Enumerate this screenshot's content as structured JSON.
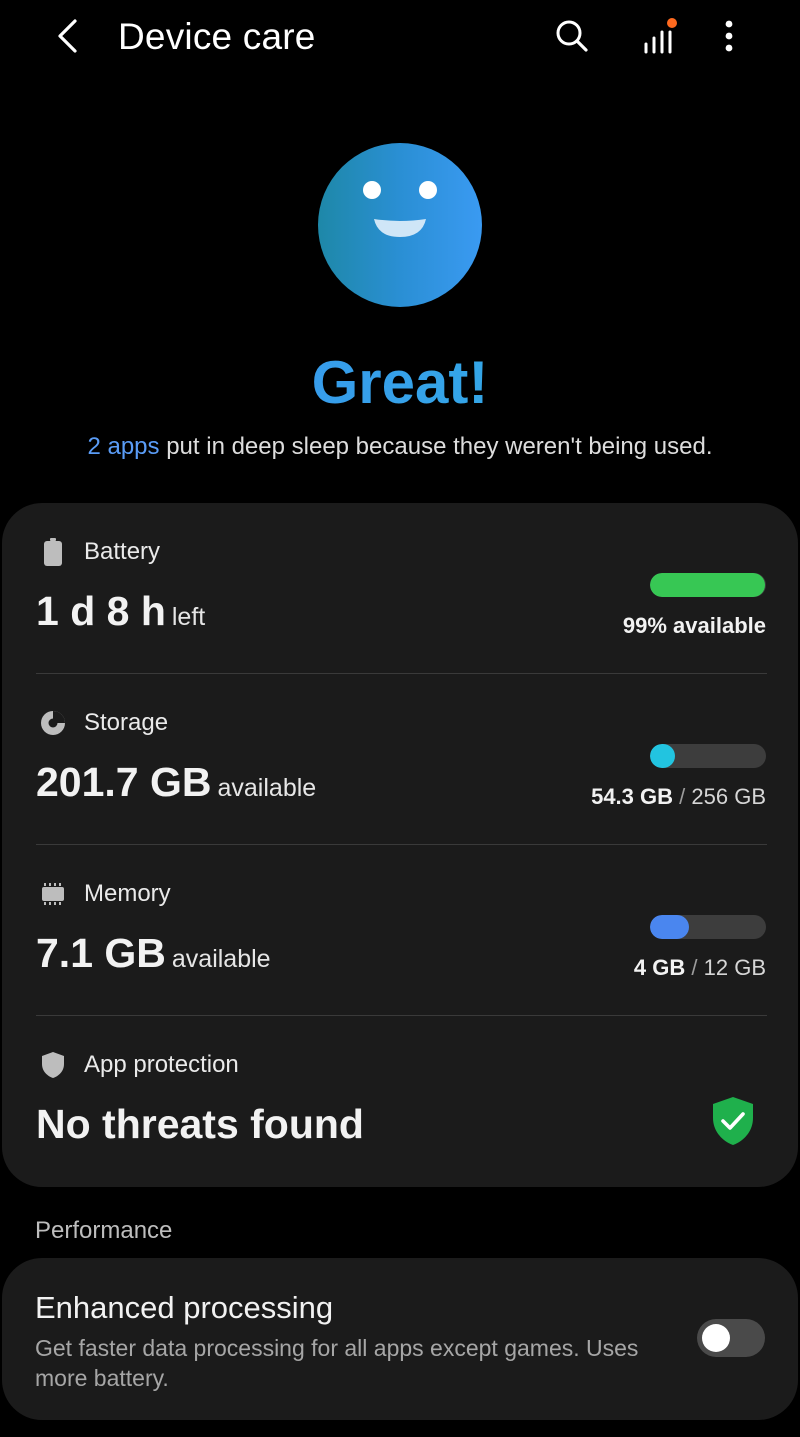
{
  "header": {
    "title": "Device care"
  },
  "status": {
    "headline": "Great!",
    "sub_link": "2 apps",
    "sub_text": " put in deep sleep because they weren't being used."
  },
  "battery": {
    "label": "Battery",
    "value": "1 d 8 h",
    "suffix": "left",
    "right": "99% available",
    "fill_fraction": 0.99,
    "color": "#37c754"
  },
  "storage": {
    "label": "Storage",
    "value": "201.7 GB",
    "suffix": "available",
    "used": "54.3 GB",
    "total": "256 GB",
    "fill_fraction": 0.212,
    "color": "#22c4e0"
  },
  "memory": {
    "label": "Memory",
    "value": "7.1 GB",
    "suffix": "available",
    "used": "4 GB",
    "total": "12 GB",
    "fill_fraction": 0.333,
    "color": "#4a86ef"
  },
  "protection": {
    "label": "App protection",
    "value": "No threats found",
    "color": "#1fb04c"
  },
  "performance": {
    "section_title": "Performance",
    "title": "Enhanced processing",
    "description": "Get faster data processing for all apps except games. Uses more battery.",
    "enabled": false
  },
  "colors": {
    "accent": "#3c8cf2",
    "notification_dot": "#ff6a1f"
  }
}
